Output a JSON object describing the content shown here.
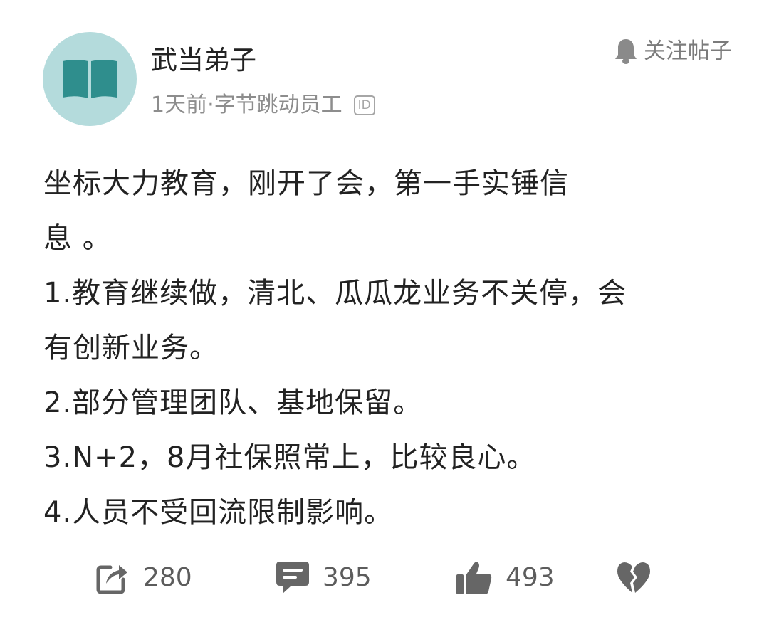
{
  "author": {
    "name": "武当弟子",
    "meta": "1天前·字节跳动员工",
    "id_badge": "ID",
    "avatar_icon": "open-book-icon"
  },
  "follow": {
    "icon": "bell-icon",
    "label": "关注帖子"
  },
  "post": {
    "lines": [
      "坐标大力教育，刚开了会，第一手实锤信",
      "息 。",
      "1.教育继续做，清北、瓜瓜龙业务不关停，会",
      "有创新业务。",
      "2.部分管理团队、基地保留。",
      "3.N+2，8月社保照常上，比较良心。",
      "4.人员不受回流限制影响。"
    ]
  },
  "actions": {
    "share": {
      "icon": "share-icon",
      "count": "280"
    },
    "comment": {
      "icon": "comment-icon",
      "count": "395"
    },
    "like": {
      "icon": "thumbs-up-icon",
      "count": "493"
    },
    "dislike": {
      "icon": "broken-heart-icon"
    }
  },
  "colors": {
    "avatar_bg": "#b4dbdc",
    "avatar_icon": "#2f8e8d",
    "icon_gray": "#666666",
    "meta_text": "#8d8d8d"
  }
}
